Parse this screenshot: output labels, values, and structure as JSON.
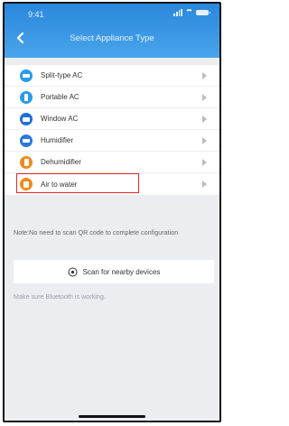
{
  "status_bar": {
    "time": "9:41"
  },
  "header": {
    "title": "Select Appliance Type"
  },
  "appliances": [
    {
      "label": "Split-type AC",
      "icon": "split-ac-icon",
      "color": "#2b9be8"
    },
    {
      "label": "Portable AC",
      "icon": "portable-ac-icon",
      "color": "#2b9be8"
    },
    {
      "label": "Window AC",
      "icon": "window-ac-icon",
      "color": "#1e6fd9"
    },
    {
      "label": "Humidifier",
      "icon": "humidifier-icon",
      "color": "#2b78d8"
    },
    {
      "label": "Dehumidifier",
      "icon": "dehumidifier-icon",
      "color": "#f08a1c"
    },
    {
      "label": "Air to water",
      "icon": "air-to-water-icon",
      "color": "#f08a1c"
    }
  ],
  "note": "Note:No need to scan QR code to complete configuration",
  "scan_button": {
    "label": "Scan for nearby devices",
    "icon": "bluetooth-scan-icon"
  },
  "bluetooth_hint": "Make sure Bluetooth is working.",
  "colors": {
    "header_top": "#2a88dd",
    "header_bottom": "#49a4ea",
    "highlight": "#e3262c"
  }
}
